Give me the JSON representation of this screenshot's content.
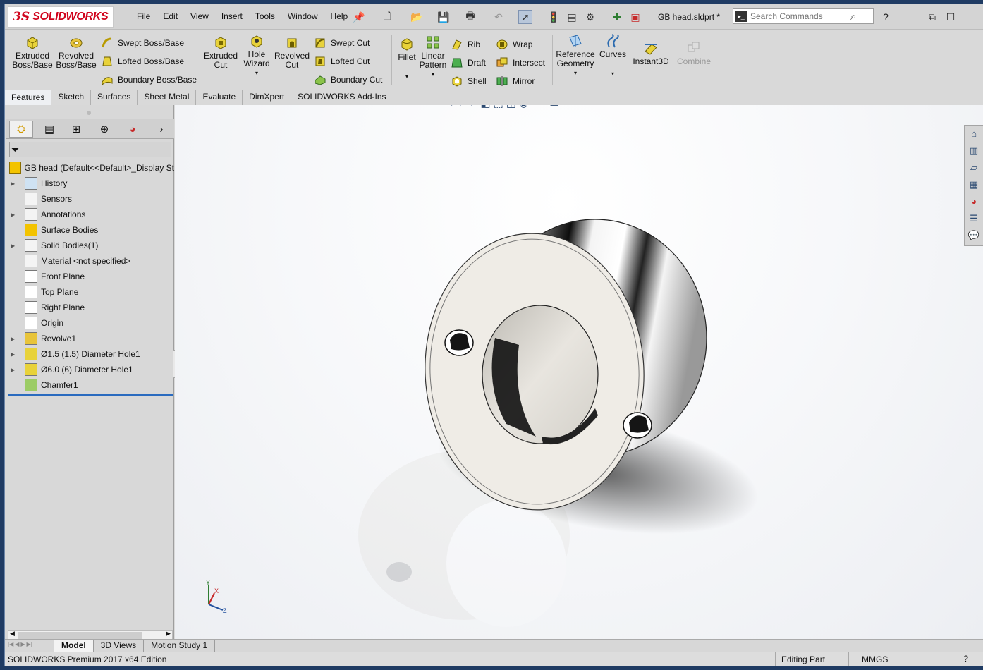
{
  "app": {
    "logo_ds": "3S",
    "logo_text": "SOLIDWORKS",
    "document_title": "GB head.sldprt *"
  },
  "menu": [
    "File",
    "Edit",
    "View",
    "Insert",
    "Tools",
    "Window",
    "Help"
  ],
  "search": {
    "placeholder": "Search Commands"
  },
  "commands": {
    "extruded_boss": "Extruded\nBoss/Base",
    "revolved_boss": "Revolved\nBoss/Base",
    "swept_boss": "Swept Boss/Base",
    "lofted_boss": "Lofted Boss/Base",
    "boundary_boss": "Boundary Boss/Base",
    "extruded_cut": "Extruded\nCut",
    "hole_wizard": "Hole\nWizard",
    "revolved_cut": "Revolved\nCut",
    "swept_cut": "Swept Cut",
    "lofted_cut": "Lofted Cut",
    "boundary_cut": "Boundary Cut",
    "fillet": "Fillet",
    "linear_pattern": "Linear\nPattern",
    "rib": "Rib",
    "draft": "Draft",
    "shell": "Shell",
    "wrap": "Wrap",
    "intersect": "Intersect",
    "mirror": "Mirror",
    "reference_geometry": "Reference\nGeometry",
    "curves": "Curves",
    "instant3d": "Instant3D",
    "combine": "Combine"
  },
  "tabs": [
    "Features",
    "Sketch",
    "Surfaces",
    "Sheet Metal",
    "Evaluate",
    "DimXpert",
    "SOLIDWORKS Add-Ins"
  ],
  "tree": {
    "root": "GB head  (Default<<Default>_Display St",
    "items": [
      {
        "label": "History",
        "expandable": true
      },
      {
        "label": "Sensors",
        "expandable": false
      },
      {
        "label": "Annotations",
        "expandable": true
      },
      {
        "label": "Surface Bodies",
        "expandable": false
      },
      {
        "label": "Solid Bodies(1)",
        "expandable": true
      },
      {
        "label": "Material <not specified>",
        "expandable": false
      },
      {
        "label": "Front Plane",
        "expandable": false
      },
      {
        "label": "Top Plane",
        "expandable": false
      },
      {
        "label": "Right Plane",
        "expandable": false
      },
      {
        "label": "Origin",
        "expandable": false
      },
      {
        "label": "Revolve1",
        "expandable": true
      },
      {
        "label": "Ø1.5 (1.5) Diameter Hole1",
        "expandable": true
      },
      {
        "label": "Ø6.0 (6) Diameter Hole1",
        "expandable": true
      },
      {
        "label": "Chamfer1",
        "expandable": false
      }
    ]
  },
  "triad": {
    "x": "X",
    "y": "Y",
    "z": "Z"
  },
  "bottom_tabs": [
    "Model",
    "3D Views",
    "Motion Study 1"
  ],
  "status": {
    "edition": "SOLIDWORKS Premium 2017 x64 Edition",
    "mode": "Editing Part",
    "units": "MMGS",
    "help": "?"
  },
  "colors": {
    "accent": "#d0021b",
    "selection": "#2a6bbf"
  }
}
